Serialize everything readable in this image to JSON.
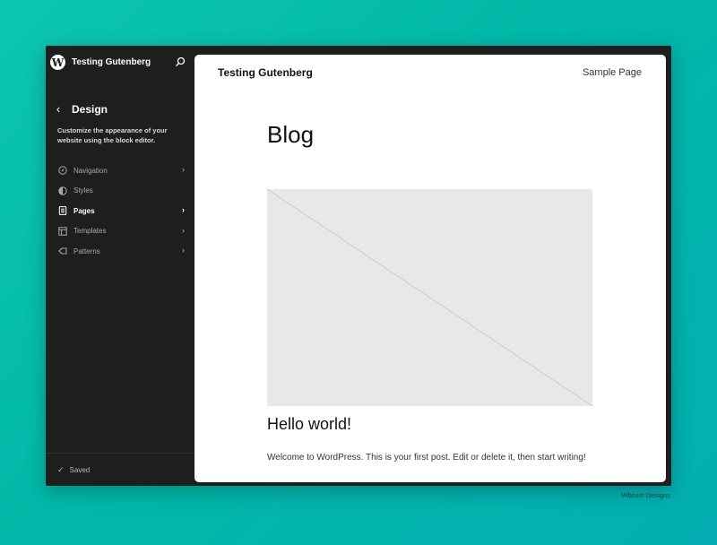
{
  "sidebar": {
    "site_title": "Testing Gutenberg",
    "section_title": "Design",
    "description": "Customize the appearance of your website using the block editor.",
    "items": [
      {
        "label": "Navigation",
        "icon": "compass-icon",
        "has_chevron": true,
        "active": false
      },
      {
        "label": "Styles",
        "icon": "half-circle-icon",
        "has_chevron": false,
        "active": false
      },
      {
        "label": "Pages",
        "icon": "page-icon",
        "has_chevron": true,
        "active": true
      },
      {
        "label": "Templates",
        "icon": "layout-icon",
        "has_chevron": true,
        "active": false
      },
      {
        "label": "Patterns",
        "icon": "diamond-icon",
        "has_chevron": true,
        "active": false
      }
    ],
    "save_status": "Saved"
  },
  "canvas": {
    "site_title": "Testing Gutenberg",
    "nav_link": "Sample Page",
    "page_heading": "Blog",
    "post_title": "Hello world!",
    "post_excerpt": "Welcome to WordPress. This is your first post. Edit or delete it, then start writing!"
  },
  "credit": "Wbcom Designs",
  "colors": {
    "background": "#0cc6b0",
    "sidebar": "#1e1e1e",
    "canvas": "#ffffff",
    "placeholder": "#e8e8e8"
  }
}
